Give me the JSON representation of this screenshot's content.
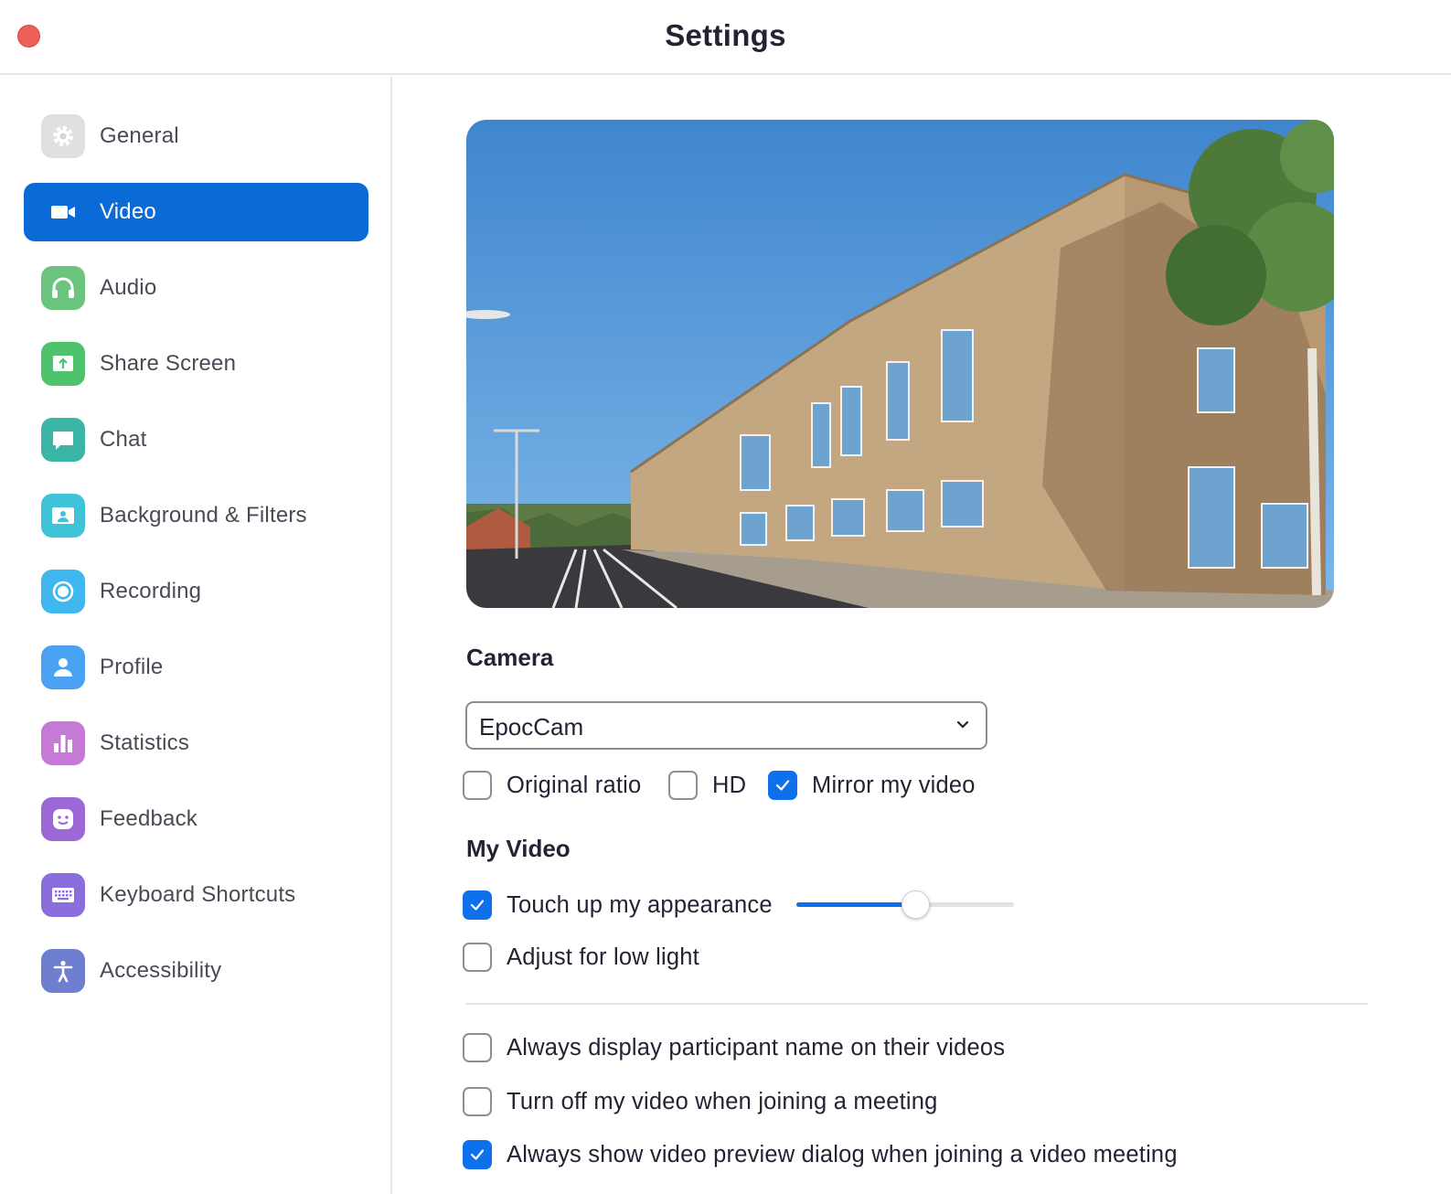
{
  "window": {
    "title": "Settings"
  },
  "sidebar": {
    "items": [
      {
        "label": "General",
        "icon": "gear-icon",
        "color": "#e0e0e0",
        "active": false
      },
      {
        "label": "Video",
        "icon": "video-camera-icon",
        "color": "#0b6bd6",
        "active": true
      },
      {
        "label": "Audio",
        "icon": "headphones-icon",
        "color": "#6cc57f",
        "active": false
      },
      {
        "label": "Share Screen",
        "icon": "share-screen-icon",
        "color": "#4fc36b",
        "active": false
      },
      {
        "label": "Chat",
        "icon": "chat-bubble-icon",
        "color": "#3ab5a6",
        "active": false
      },
      {
        "label": "Background & Filters",
        "icon": "background-icon",
        "color": "#3fc3d8",
        "active": false
      },
      {
        "label": "Recording",
        "icon": "record-icon",
        "color": "#40b8ef",
        "active": false
      },
      {
        "label": "Profile",
        "icon": "person-icon",
        "color": "#4aa3f2",
        "active": false
      },
      {
        "label": "Statistics",
        "icon": "bar-chart-icon",
        "color": "#c57ad6",
        "active": false
      },
      {
        "label": "Feedback",
        "icon": "smiley-icon",
        "color": "#9d67d6",
        "active": false
      },
      {
        "label": "Keyboard Shortcuts",
        "icon": "keyboard-icon",
        "color": "#8a6fdc",
        "active": false
      },
      {
        "label": "Accessibility",
        "icon": "accessibility-icon",
        "color": "#6f7fcf",
        "active": false
      }
    ]
  },
  "main": {
    "camera": {
      "heading": "Camera",
      "selected": "EpocCam"
    },
    "camera_options": [
      {
        "label": "Original ratio",
        "checked": false
      },
      {
        "label": "HD",
        "checked": false
      },
      {
        "label": "Mirror my video",
        "checked": true
      }
    ],
    "my_video": {
      "heading": "My Video",
      "touch_up": {
        "label": "Touch up my appearance",
        "checked": true,
        "level": 0.55
      },
      "low_light": {
        "label": "Adjust for low light",
        "checked": false
      }
    },
    "general_options": [
      {
        "label": "Always display participant name on their videos",
        "checked": false
      },
      {
        "label": "Turn off my video when joining a meeting",
        "checked": false
      },
      {
        "label": "Always show video preview dialog when joining a video meeting",
        "checked": true
      }
    ]
  },
  "colors": {
    "accent": "#0e71eb",
    "active_nav": "#0b6bd6",
    "close_button": "#ed5f57"
  }
}
